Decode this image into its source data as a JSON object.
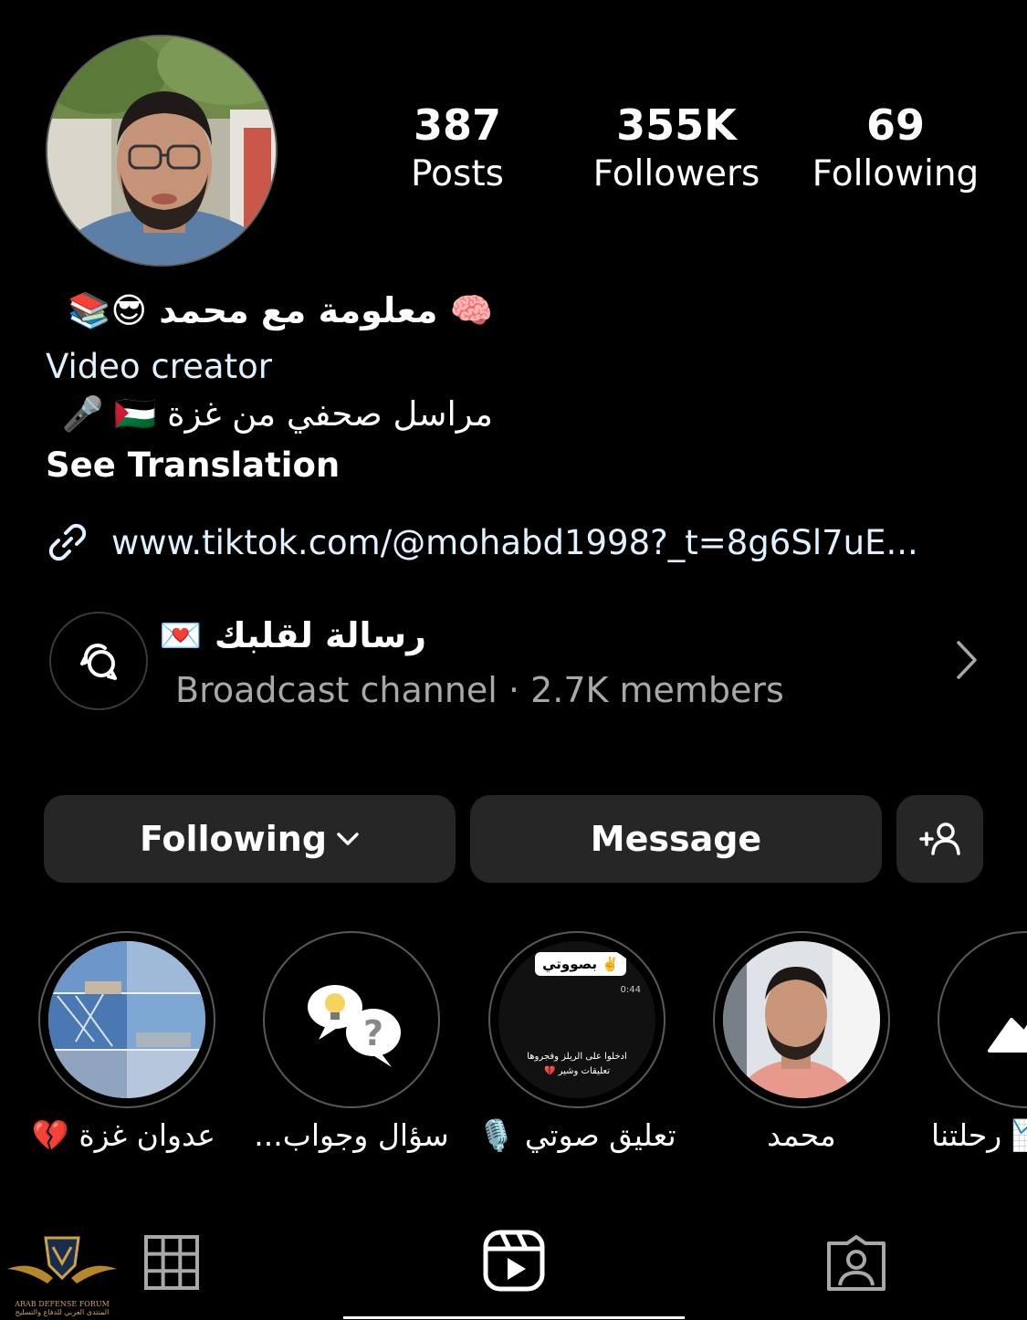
{
  "profile": {
    "stats": [
      {
        "value": "387",
        "label": "Posts"
      },
      {
        "value": "355K",
        "label": "Followers"
      },
      {
        "value": "69",
        "label": "Following"
      }
    ],
    "bio_name": "🧠 معلومة مع محمد 😎📚",
    "category": "Video creator",
    "description": "مراسل صحفي من غزة 🇵🇸 🎤",
    "see_translation": "See Translation",
    "link": "www.tiktok.com/@mohabd1998?_t=8g6Sl7uE..."
  },
  "channel": {
    "title": "رسالة لقلبك 💌",
    "subtitle": "Broadcast channel · 2.7K members"
  },
  "actions": {
    "following": "Following",
    "message": "Message"
  },
  "highlights": [
    {
      "label": "عدوان غزة 💔"
    },
    {
      "label": "سؤال وجواب..."
    },
    {
      "label": "تعليق صوتي 🎙️"
    },
    {
      "label": "محمد"
    },
    {
      "label": "📉 رحلتنا"
    }
  ],
  "highlight_overlay": {
    "voice_tag": "بصووتي ✌️",
    "voice_time": "0:44",
    "voice_caption_1": "ادخلوا على الريلز وفجروها",
    "voice_caption_2": "تعليقات وشير 💔"
  },
  "tabs": [
    "grid-icon",
    "reels-icon",
    "tagged-icon"
  ],
  "watermark": {
    "text_en": "ARAB DEFENSE FORUM",
    "text_ar": "المنتدى العربي للدفاع والتسليح"
  }
}
